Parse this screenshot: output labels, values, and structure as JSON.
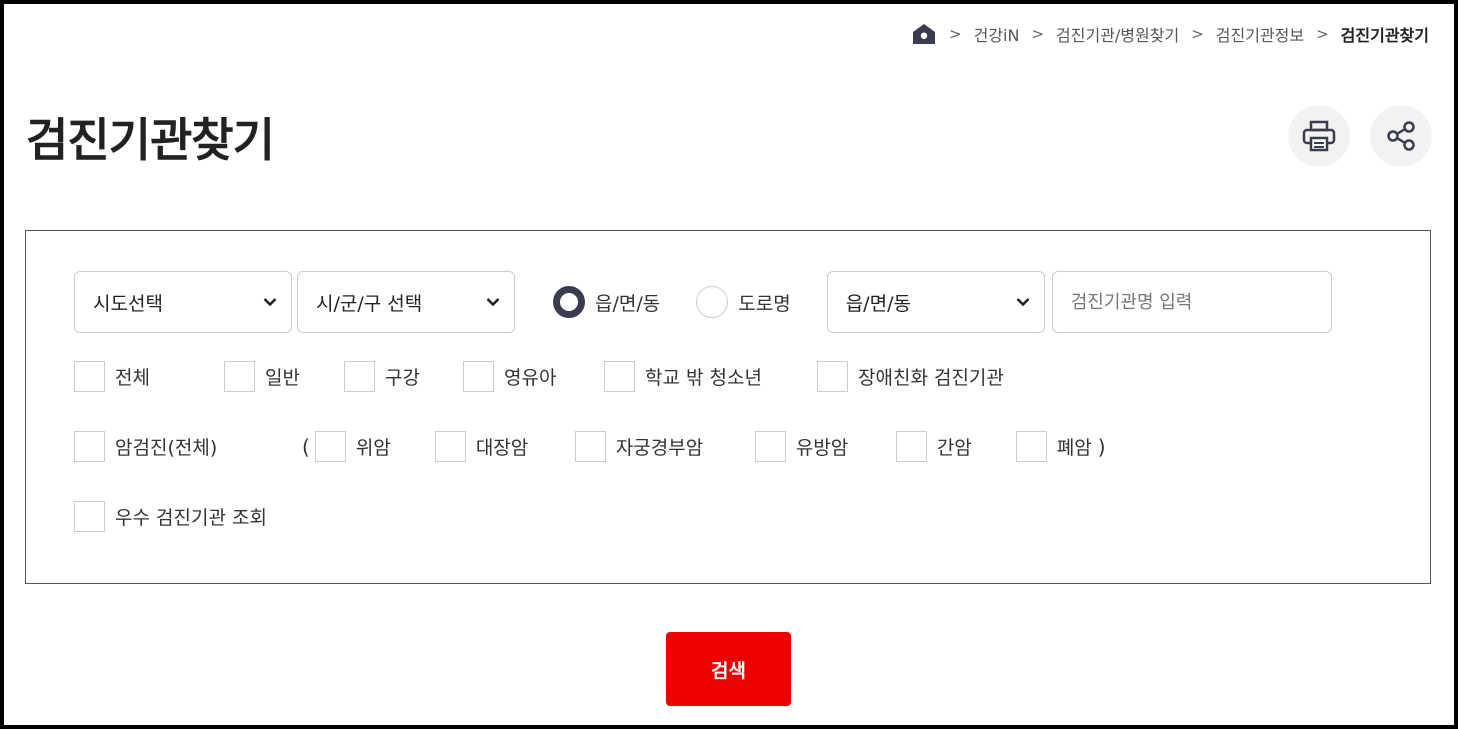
{
  "breadcrumb": {
    "items": [
      "건강iN",
      "검진기관/병원찾기",
      "검진기관정보"
    ],
    "current": "검진기관찾기",
    "separator": ">"
  },
  "page": {
    "title": "검진기관찾기"
  },
  "search": {
    "sido_select": "시도선택",
    "sigungu_select": "시/군/구 선택",
    "address_type": {
      "options": [
        "읍/면/동",
        "도로명"
      ],
      "selected": "읍/면/동"
    },
    "emd_select": "읍/면/동",
    "name_placeholder": "검진기관명 입력",
    "name_value": ""
  },
  "filters": {
    "types": [
      "전체",
      "일반",
      "구강",
      "영유아",
      "학교 밖 청소년",
      "장애친화 검진기관"
    ],
    "cancer_all": "암검진(전체)",
    "paren_open": "(",
    "paren_close": ")",
    "cancers": [
      "위암",
      "대장암",
      "자궁경부암",
      "유방암",
      "간암",
      "폐암"
    ],
    "excellent": "우수 검진기관 조회"
  },
  "actions": {
    "search_label": "검색"
  },
  "colors": {
    "accent": "#ee0000",
    "radio": "#3a3d4f"
  },
  "icons": {
    "home": "home-icon",
    "print": "print-icon",
    "share": "share-icon",
    "chevron": "chevron-down-icon"
  }
}
